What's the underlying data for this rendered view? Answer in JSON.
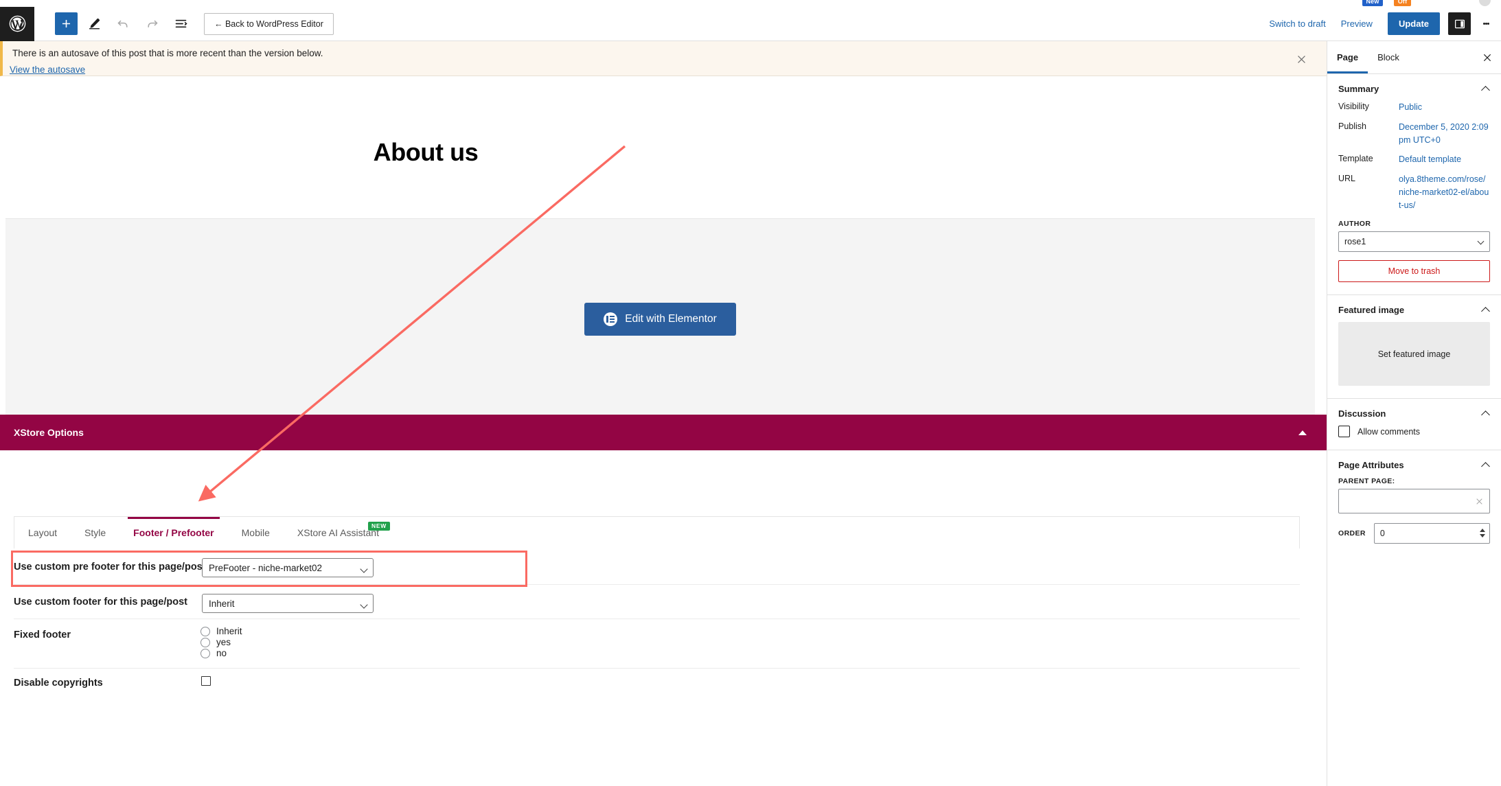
{
  "browser": {
    "ext_badge_new": "New",
    "ext_badge_off": "Off"
  },
  "topbar": {
    "add_block_title": "Add block",
    "back_to_editor_label": "← Back to WordPress Editor",
    "switch_to_draft_label": "Switch to draft",
    "preview_label": "Preview",
    "update_label": "Update"
  },
  "notice": {
    "text": "There is an autosave of this post that is more recent than the version below.",
    "link_label": "View the autosave"
  },
  "canvas": {
    "page_title": "About us",
    "edit_with_elementor_label": "Edit with Elementor"
  },
  "xstore": {
    "panel_title": "XStore Options",
    "tabs": [
      {
        "label": "Layout",
        "active": false,
        "badge": ""
      },
      {
        "label": "Style",
        "active": false,
        "badge": ""
      },
      {
        "label": "Footer / Prefooter",
        "active": true,
        "badge": ""
      },
      {
        "label": "Mobile",
        "active": false,
        "badge": ""
      },
      {
        "label": "XStore AI Assistant",
        "active": false,
        "badge": "NEW"
      }
    ],
    "rows": {
      "pre_footer_label": "Use custom pre footer for this page/post",
      "pre_footer_value": "PreFooter - niche-market02",
      "footer_label": "Use custom footer for this page/post",
      "footer_value": "Inherit",
      "fixed_footer_label": "Fixed footer",
      "fixed_footer_options": [
        "Inherit",
        "yes",
        "no"
      ],
      "disable_copyrights_label": "Disable copyrights"
    }
  },
  "sidebar": {
    "tabs": [
      {
        "label": "Page",
        "active": true
      },
      {
        "label": "Block",
        "active": false
      }
    ],
    "summary": {
      "title": "Summary",
      "rows": [
        {
          "key": "Visibility",
          "value": "Public"
        },
        {
          "key": "Publish",
          "value": "December 5, 2020 2:09 pm UTC+0"
        },
        {
          "key": "Template",
          "value": "Default template"
        },
        {
          "key": "URL",
          "value": "olya.8theme.com/rose/niche-market02-el/about-us/"
        }
      ],
      "author_label": "AUTHOR",
      "author_value": "rose1",
      "move_to_trash_label": "Move to trash"
    },
    "featured_image": {
      "title": "Featured image",
      "set_label": "Set featured image"
    },
    "discussion": {
      "title": "Discussion",
      "allow_comments_label": "Allow comments"
    },
    "page_attributes": {
      "title": "Page Attributes",
      "parent_page_label": "PARENT PAGE:",
      "parent_page_value": "",
      "order_label": "ORDER",
      "order_value": "0"
    }
  },
  "colors": {
    "brand_maroon": "#930544",
    "accent_blue": "#1e66ad",
    "annotation_red": "#fa6a62",
    "notice_amber": "#f0b849",
    "badge_green": "#21a14b"
  }
}
